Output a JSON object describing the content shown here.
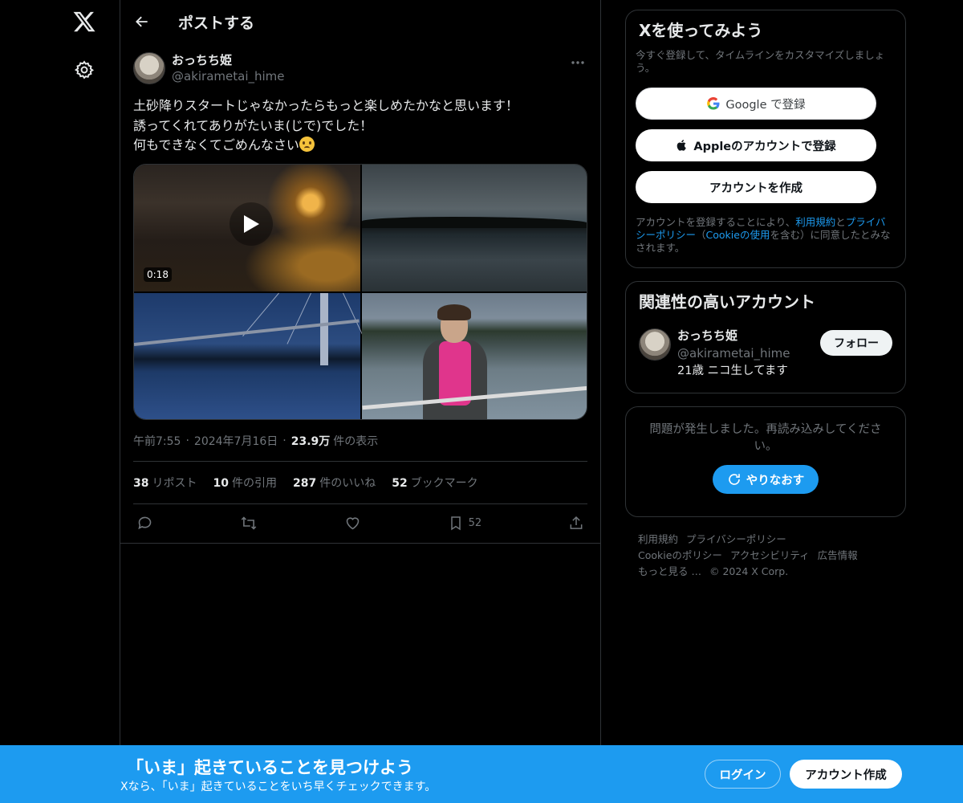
{
  "header": {
    "title": "ポストする"
  },
  "post": {
    "author_name": "おっちち姫",
    "author_handle": "@akirametai_hime",
    "text_line1": "土砂降りスタートじゃなかったらもっと楽しめたかなと思います！",
    "text_line2": "誘ってくれてありがたいま(じで)でした！",
    "text_line3": "何もできなくてごめんなさい",
    "video_duration": "0:18",
    "time": "午前7:55",
    "date": "2024年7月16日",
    "views_count": "23.9万",
    "views_label": "件の表示",
    "stats": {
      "reposts_count": "38",
      "reposts_label": "リポスト",
      "quotes_count": "10",
      "quotes_label": "件の引用",
      "likes_count": "287",
      "likes_label": "件のいいね",
      "bookmarks_count": "52",
      "bookmarks_label": "ブックマーク"
    },
    "bookmark_action_count": "52"
  },
  "signup": {
    "title": "Xを使ってみよう",
    "subtitle": "今すぐ登録して、タイムラインをカスタマイズしましょう。",
    "google_btn": "Google で登録",
    "apple_btn": "Appleのアカウントで登録",
    "create_btn": "アカウントを作成",
    "legal_prefix": "アカウントを登録することにより、",
    "legal_terms": "利用規約",
    "legal_and": "と",
    "legal_privacy": "プライバシーポリシー",
    "legal_open": "（",
    "legal_cookie": "Cookieの使用",
    "legal_suffix": "を含む）に同意したとみなされます。"
  },
  "related": {
    "title": "関連性の高いアカウント",
    "name": "おっちち姫",
    "handle": "@akirametai_hime",
    "bio": "21歳 ニコ生してます",
    "follow_btn": "フォロー"
  },
  "error": {
    "message": "問題が発生しました。再読み込みしてください。",
    "retry_btn": "やりなおす"
  },
  "footer": {
    "terms": "利用規約",
    "privacy": "プライバシーポリシー",
    "cookie": "Cookieのポリシー",
    "accessibility": "アクセシビリティ",
    "ads": "広告情報",
    "more": "もっと見る …",
    "copyright": "© 2024 X Corp."
  },
  "banner": {
    "title": "「いま」起きていることを見つけよう",
    "subtitle": "Xなら、「いま」起きていることをいち早くチェックできます。",
    "login_btn": "ログイン",
    "create_btn": "アカウント作成"
  },
  "colors": {
    "accent": "#1d9bf0",
    "background": "#000000",
    "border": "#2f3336",
    "muted": "#71767b"
  }
}
